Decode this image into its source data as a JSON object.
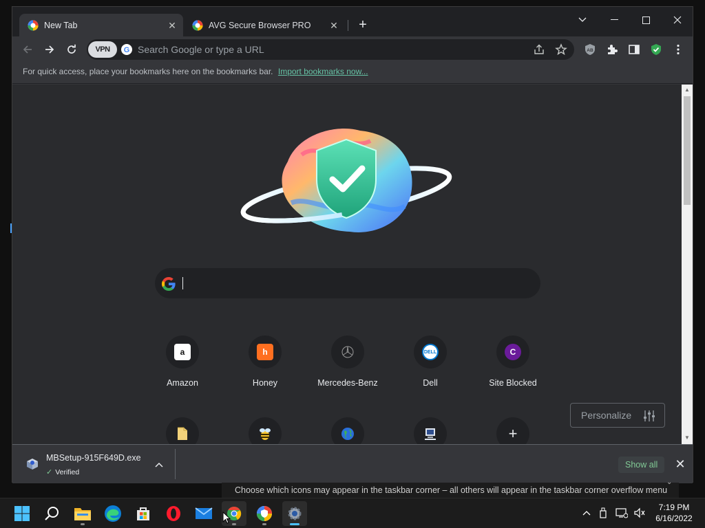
{
  "tabs": [
    {
      "title": "New Tab",
      "active": true
    },
    {
      "title": "AVG Secure Browser PRO",
      "active": false
    }
  ],
  "toolbar": {
    "vpn_label": "VPN",
    "omnibox_placeholder": "Search Google or type a URL"
  },
  "bookmarks_bar": {
    "hint": "For quick access, place your bookmarks here on the bookmarks bar.",
    "import_link": "Import bookmarks now..."
  },
  "shortcuts": [
    {
      "label": "Amazon",
      "icon": "amazon-logo",
      "glyph": "a",
      "color": "#ffffff",
      "fg": "#111111"
    },
    {
      "label": "Honey",
      "icon": "honey-logo",
      "glyph": "h",
      "color": "#ff6f20",
      "fg": "#ffffff"
    },
    {
      "label": "Mercedes-Benz",
      "icon": "mercedes-logo",
      "glyph": "",
      "color": "#202124",
      "fg": "#bbbbbb"
    },
    {
      "label": "Dell",
      "icon": "dell-logo",
      "glyph": "DELL",
      "color": "#ffffff",
      "fg": "#0076ce"
    },
    {
      "label": "Site Blocked",
      "icon": "letter-c",
      "glyph": "C",
      "color": "#6a1b9a",
      "fg": "#ffffff"
    }
  ],
  "shortcuts_row2": [
    {
      "icon": "folder-icon"
    },
    {
      "icon": "bee-icon"
    },
    {
      "icon": "globe-icon"
    },
    {
      "icon": "computer-icon"
    },
    {
      "icon": "add-shortcut-icon",
      "glyph": "+"
    }
  ],
  "personalize_label": "Personalize",
  "download": {
    "file_name": "MBSetup-915F649D.exe",
    "status": "Verified",
    "show_all": "Show all"
  },
  "tooltip": "Choose which icons may appear in the taskbar corner – all others will appear in the taskbar corner overflow menu",
  "taskbar": {
    "apps": [
      "start-icon",
      "search-icon",
      "file-explorer-icon",
      "edge-icon",
      "store-icon",
      "opera-icon",
      "mail-icon",
      "chrome-icon",
      "avg-browser-icon",
      "settings-icon"
    ],
    "time": "7:19 PM",
    "date": "6/16/2022"
  },
  "colors": {
    "accent_green": "#81c995",
    "link": "#66c2a5",
    "taskbar_active": "#4cc2ff"
  }
}
